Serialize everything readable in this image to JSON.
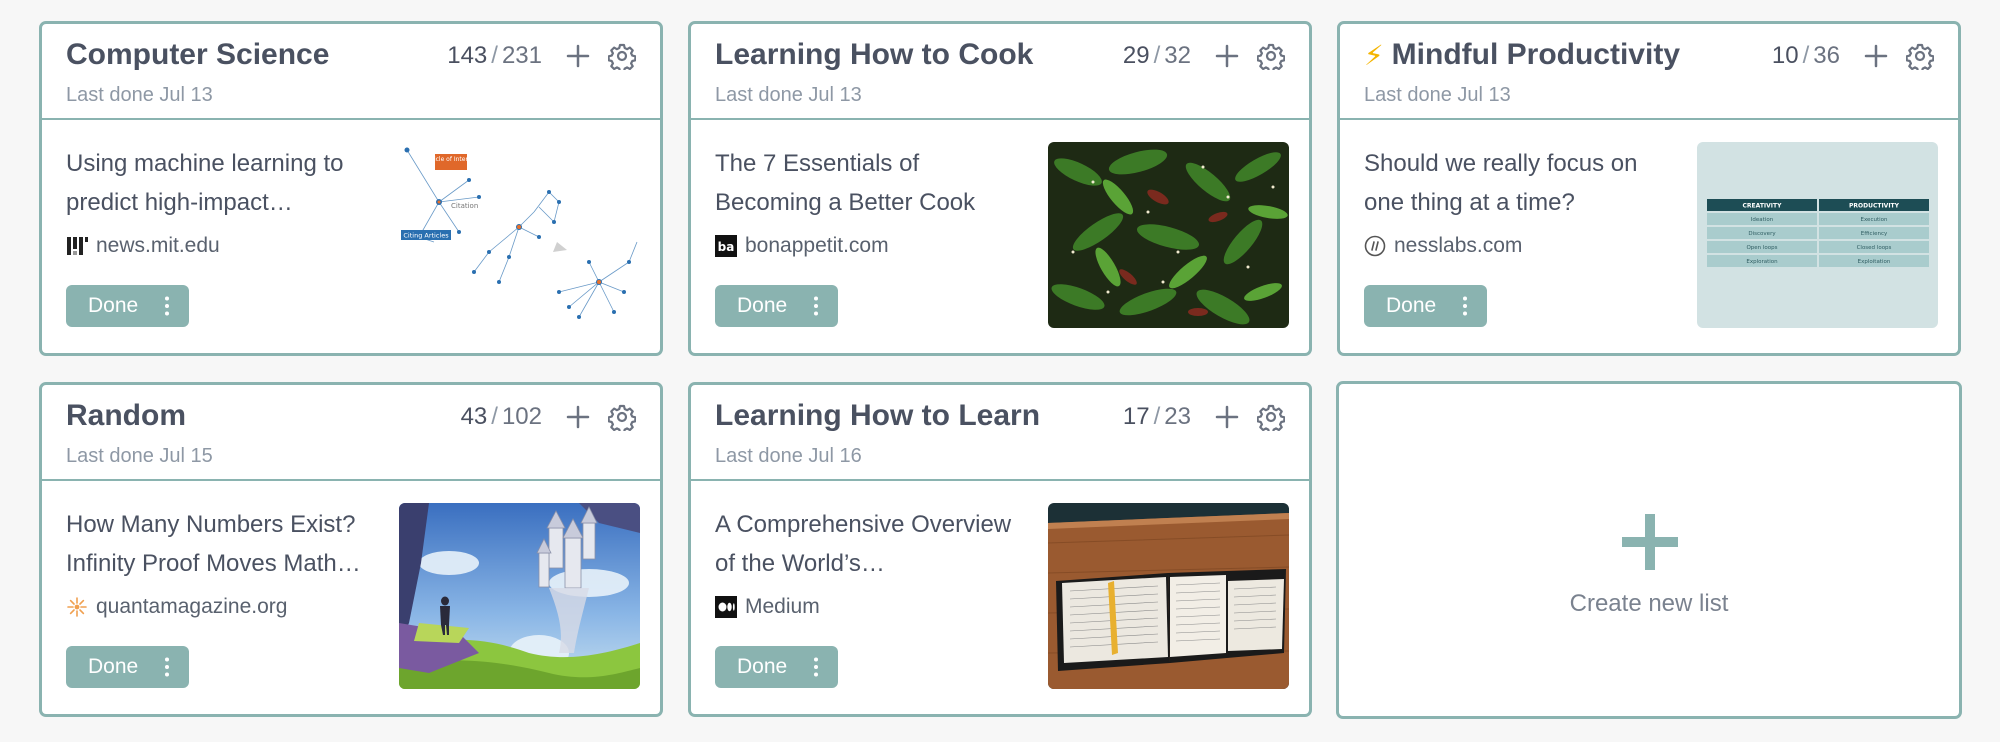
{
  "lists": [
    {
      "title": "Computer Science",
      "last_done": "Last done Jul 13",
      "done_count": "143",
      "count_sep": "/",
      "total_count": "231",
      "article_title": "Using machine learning to predict high-impact…",
      "source": "news.mit.edu",
      "source_icon": "mit-logo-icon",
      "done_label": "Done",
      "thumbnail": "network-graph-image",
      "thumb_labels": {
        "interest": "Article of Interest",
        "citation": "Citation",
        "citing": "Citing Articles"
      }
    },
    {
      "title": "Learning How to Cook",
      "last_done": "Last done Jul 13",
      "done_count": "29",
      "count_sep": "/",
      "total_count": "32",
      "article_title": "The 7 Essentials of Becoming a Better Cook",
      "source": "bonappetit.com",
      "source_icon": "ba-logo-icon",
      "done_label": "Done",
      "thumbnail": "green-beans-dish-image"
    },
    {
      "title": "Mindful Productivity",
      "title_icon": "lightning-icon",
      "last_done": "Last done Jul 13",
      "done_count": "10",
      "count_sep": "/",
      "total_count": "36",
      "article_title": "Should we really focus on one thing at a time?",
      "source": "nesslabs.com",
      "source_icon": "nesslabs-logo-icon",
      "done_label": "Done",
      "thumbnail": "creativity-productivity-table-image",
      "thumb_table": {
        "headers": [
          "CREATIVITY",
          "PRODUCTIVITY"
        ],
        "rows": [
          [
            "Ideation",
            "Execution"
          ],
          [
            "Discovery",
            "Efficiency"
          ],
          [
            "Open loops",
            "Closed loops"
          ],
          [
            "Exploration",
            "Exploitation"
          ]
        ]
      }
    },
    {
      "title": "Random",
      "last_done": "Last done Jul 15",
      "done_count": "43",
      "count_sep": "/",
      "total_count": "102",
      "article_title": "How Many Numbers Exist? Infinity Proof Moves Math…",
      "source": "quantamagazine.org",
      "source_icon": "quanta-logo-icon",
      "done_label": "Done",
      "thumbnail": "fantasy-castle-illustration-image"
    },
    {
      "title": "Learning How to Learn",
      "last_done": "Last done Jul 16",
      "done_count": "17",
      "count_sep": "/",
      "total_count": "23",
      "article_title": "A Comprehensive Overview of the World’s…",
      "source": "Medium",
      "source_icon": "medium-logo-icon",
      "done_label": "Done",
      "thumbnail": "open-book-on-table-image"
    }
  ],
  "create_new": {
    "label": "Create new list",
    "icon": "plus-icon"
  },
  "colors": {
    "accent": "#8ab3b0",
    "title": "#4a5161",
    "muted": "#8e98a5"
  }
}
